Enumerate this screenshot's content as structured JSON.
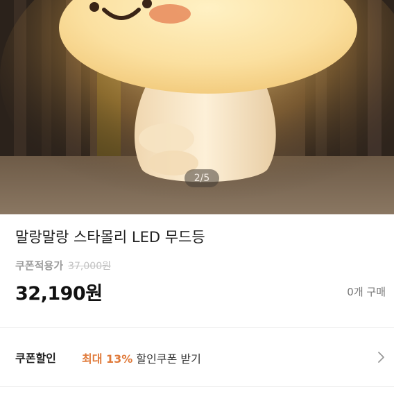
{
  "gallery": {
    "counter": "2/5"
  },
  "product": {
    "title": "말랑말랑 스타몰리 LED 무드등",
    "coupon_label": "쿠폰적용가",
    "original_price": "37,000원",
    "price": "32,190원",
    "purchase_count": "0개 구매"
  },
  "coupon_discount": {
    "label": "쿠폰할인",
    "highlight": "최대 13%",
    "text": "할인쿠폰 받기",
    "chevron_icon": "chevron-right-icon"
  },
  "colors": {
    "accent": "#e07a3a",
    "lamp": "#fbe3a2",
    "cheek": "#e98f60"
  }
}
